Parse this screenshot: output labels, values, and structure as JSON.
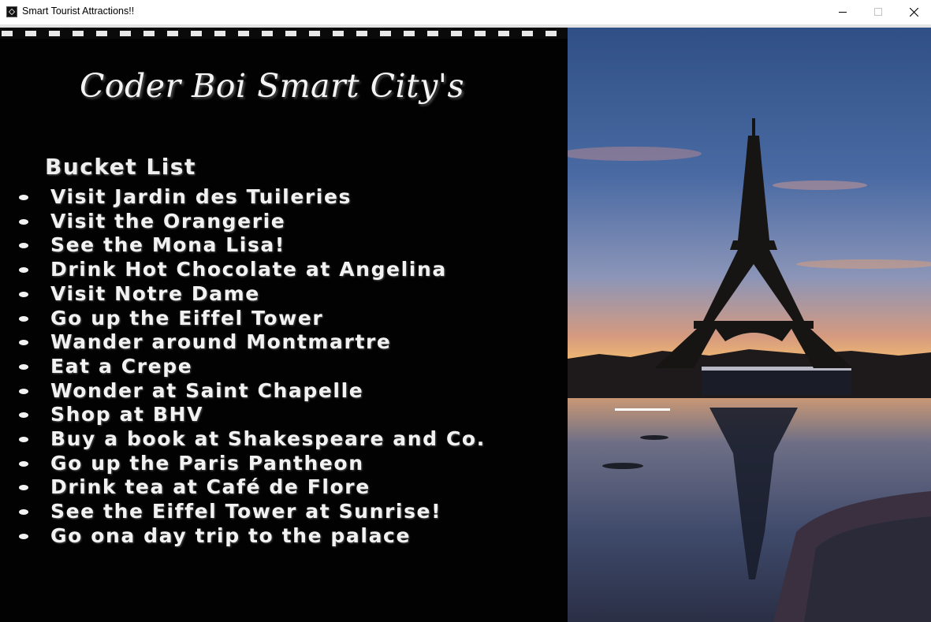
{
  "window": {
    "title": "Smart Tourist Attractions!!",
    "icons": {
      "app": "app-icon",
      "minimize": "minimize-icon",
      "maximize": "maximize-icon",
      "close": "close-icon"
    }
  },
  "header": {
    "title": "Coder Boi Smart City's"
  },
  "bucket_list": {
    "heading": "Bucket List",
    "items": [
      "Visit Jardin des Tuileries",
      "Visit the Orangerie",
      "See the Mona Lisa!",
      "Drink Hot Chocolate at Angelina",
      "Visit Notre Dame",
      "Go up the Eiffel Tower",
      "Wander around Montmartre",
      "Eat a Crepe",
      "Wonder at Saint Chapelle",
      "Shop at BHV",
      "Buy a book at Shakespeare and Co.",
      "Go up the Paris Pantheon",
      "Drink tea at Café de Flore",
      "See the Eiffel Tower at Sunrise!",
      "Go ona day trip to the palace"
    ]
  },
  "photo": {
    "subject": "eiffel-tower-sunrise-image"
  },
  "colors": {
    "panel_bg": "#020202",
    "text": "#f2f2f2",
    "titlebar_bg": "#ffffff"
  }
}
